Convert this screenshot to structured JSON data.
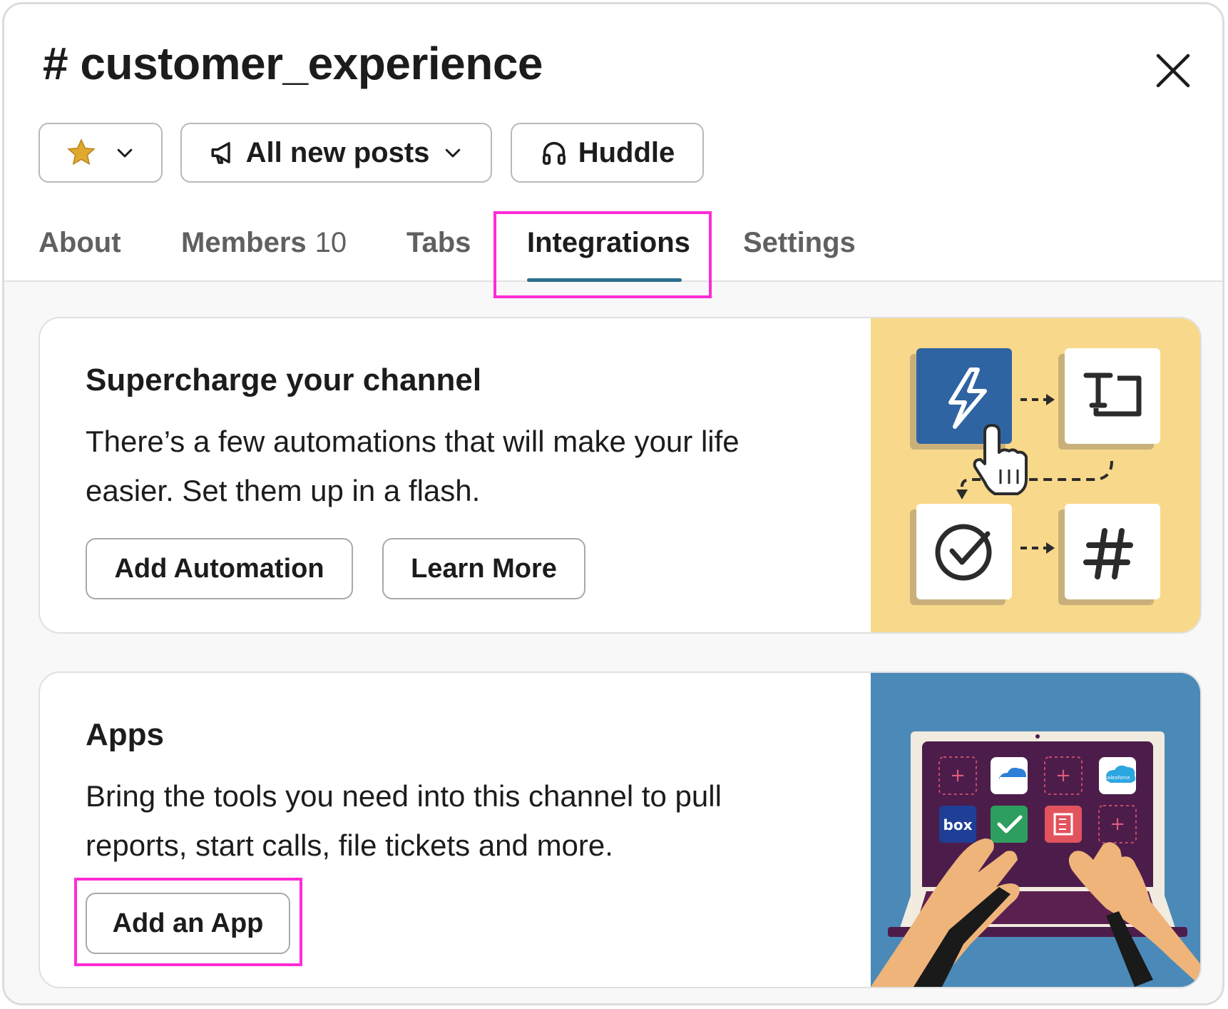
{
  "header": {
    "title": "# customer_experience",
    "close_icon": "close-icon"
  },
  "actions": {
    "star_icon": "star-icon",
    "notifications_label": "All new posts",
    "huddle_label": "Huddle"
  },
  "tabs": [
    {
      "label": "About"
    },
    {
      "label": "Members",
      "count": "10"
    },
    {
      "label": "Tabs"
    },
    {
      "label": "Integrations",
      "active": true
    },
    {
      "label": "Settings"
    }
  ],
  "automation_card": {
    "title": "Supercharge your channel",
    "body": "There’s a few automations that will make your life easier. Set them up in a flash.",
    "primary_button": "Add Automation",
    "secondary_button": "Learn More"
  },
  "apps_card": {
    "title": "Apps",
    "body": "Bring the tools you need into this channel to pull reports, start calls, file tickets and more.",
    "button": "Add an App",
    "illustration_app_labels": [
      "box",
      "salesforce"
    ]
  },
  "colors": {
    "accent_underline": "#2a6e8c",
    "highlight": "#ff2bd7",
    "star": "#e0a82e",
    "automation_art_bg": "#f8d88a",
    "apps_art_bg": "#4b8ab8"
  }
}
